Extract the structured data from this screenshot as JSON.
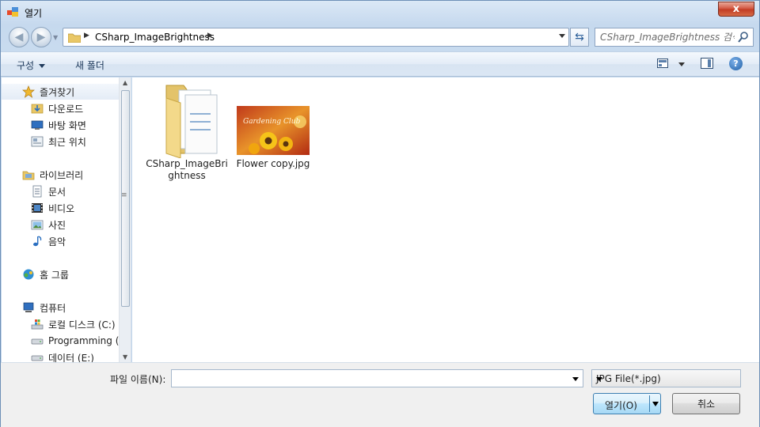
{
  "window": {
    "title": "열기",
    "close_glyph": "x"
  },
  "nav": {
    "address_path": "CSharp_ImageBrightness",
    "search_placeholder": "CSharp_ImageBrightness 검색"
  },
  "toolbar": {
    "organize": "구성",
    "new_folder": "새 폴더"
  },
  "sidebar": {
    "favorites": "즐겨찾기",
    "downloads": "다운로드",
    "desktop": "바탕 화면",
    "recent": "최근 위치",
    "libraries": "라이브러리",
    "documents": "문서",
    "videos": "비디오",
    "pictures": "사진",
    "music": "음악",
    "homegroup": "홈 그룹",
    "computer": "컴퓨터",
    "local_disk": "로컬 디스크 (C:)",
    "programming": "Programming (D",
    "data": "데이터 (E:)"
  },
  "files": [
    {
      "line1": "CSharp_ImageBri",
      "line2": "ghtness"
    },
    {
      "line1": "Flower copy.jpg",
      "thumb_text": "Gardening Club"
    }
  ],
  "bottom": {
    "filename_label": "파일 이름(N):",
    "filename_value": "",
    "filetype": "JPG File(*.jpg)",
    "open": "열기(O)",
    "cancel": "취소"
  },
  "colors": {
    "accent": "#3c7fb1",
    "close": "#c13a23"
  }
}
